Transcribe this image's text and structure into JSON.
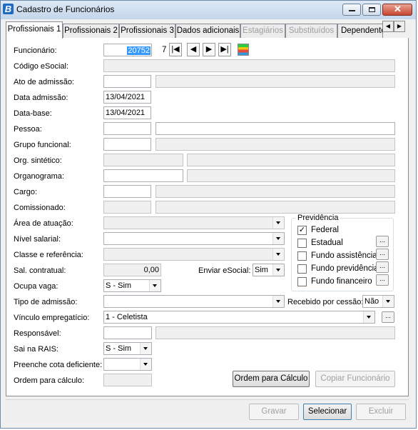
{
  "window": {
    "title": "Cadastro de Funcionários",
    "icon": "B"
  },
  "tabs": [
    {
      "label": "Profissionais 1"
    },
    {
      "label": "Profissionais 2"
    },
    {
      "label": "Profissionais 3"
    },
    {
      "label": "Dados adicionais"
    },
    {
      "label": "Estagiários"
    },
    {
      "label": "Substituídos"
    },
    {
      "label": "Dependentes"
    }
  ],
  "form": {
    "funcionario": {
      "label": "Funcionário:",
      "code": "20752",
      "digit": "7"
    },
    "codigo_esocial": {
      "label": "Código eSocial:",
      "value": ""
    },
    "ato_admissao": {
      "label": "Ato de admissão:",
      "value": "",
      "desc": ""
    },
    "data_admissao": {
      "label": "Data admissão:",
      "value": "13/04/2021"
    },
    "data_base": {
      "label": "Data-base:",
      "value": "13/04/2021"
    },
    "pessoa": {
      "label": "Pessoa:",
      "value": "",
      "desc": ""
    },
    "grupo_funcional": {
      "label": "Grupo funcional:",
      "value": "",
      "desc": ""
    },
    "org_sintetico": {
      "label": "Org. sintético:",
      "value": "",
      "desc": ""
    },
    "organograma": {
      "label": "Organograma:",
      "value": "",
      "desc": ""
    },
    "cargo": {
      "label": "Cargo:",
      "value": "",
      "desc": ""
    },
    "comissionado": {
      "label": "Comissionado:",
      "value": "",
      "desc": ""
    },
    "area_atuacao": {
      "label": "Área de atuação:",
      "value": ""
    },
    "nivel_salarial": {
      "label": "Nível salarial:",
      "value": ""
    },
    "classe_referencia": {
      "label": "Classe e referência:",
      "value": ""
    },
    "sal_contratual": {
      "label": "Sal. contratual:",
      "value": "0,00"
    },
    "enviar_esocial": {
      "label": "Enviar eSocial:",
      "value": "Sim"
    },
    "ocupa_vaga": {
      "label": "Ocupa vaga:",
      "value": "S - Sim"
    },
    "tipo_admissao": {
      "label": "Tipo de admissão:",
      "value": ""
    },
    "recebido_cessao": {
      "label": "Recebido por cessão:",
      "value": "Não"
    },
    "vinculo": {
      "label": "Vínculo empregatício:",
      "value": "1 - Celetista"
    },
    "responsavel": {
      "label": "Responsável:",
      "value": "",
      "desc": ""
    },
    "sai_rais": {
      "label": "Sai na RAIS:",
      "value": "S - Sim"
    },
    "cota_deficiente": {
      "label": "Preenche cota deficiente:",
      "value": ""
    },
    "ordem_calculo": {
      "label": "Ordem para cálculo:",
      "value": ""
    }
  },
  "previdencia": {
    "title": "Previdência",
    "federal": {
      "label": "Federal",
      "checked": true
    },
    "estadual": {
      "label": "Estadual",
      "checked": false
    },
    "fundo_assistencia": {
      "label": "Fundo assistência",
      "checked": false
    },
    "fundo_previdencia": {
      "label": "Fundo previdência",
      "checked": false
    },
    "fundo_financeiro": {
      "label": "Fundo financeiro",
      "checked": false
    }
  },
  "buttons": {
    "ordem_calculo": "Ordem para Cálculo",
    "copiar_funcionario": "Copiar Funcionário",
    "gravar": "Gravar",
    "selecionar": "Selecionar",
    "excluir": "Excluir",
    "lookup": "..."
  },
  "colors": {
    "title_bar": "#c4d6ea",
    "selection": "#3399ff",
    "window_bg": "#f0f0f0"
  }
}
